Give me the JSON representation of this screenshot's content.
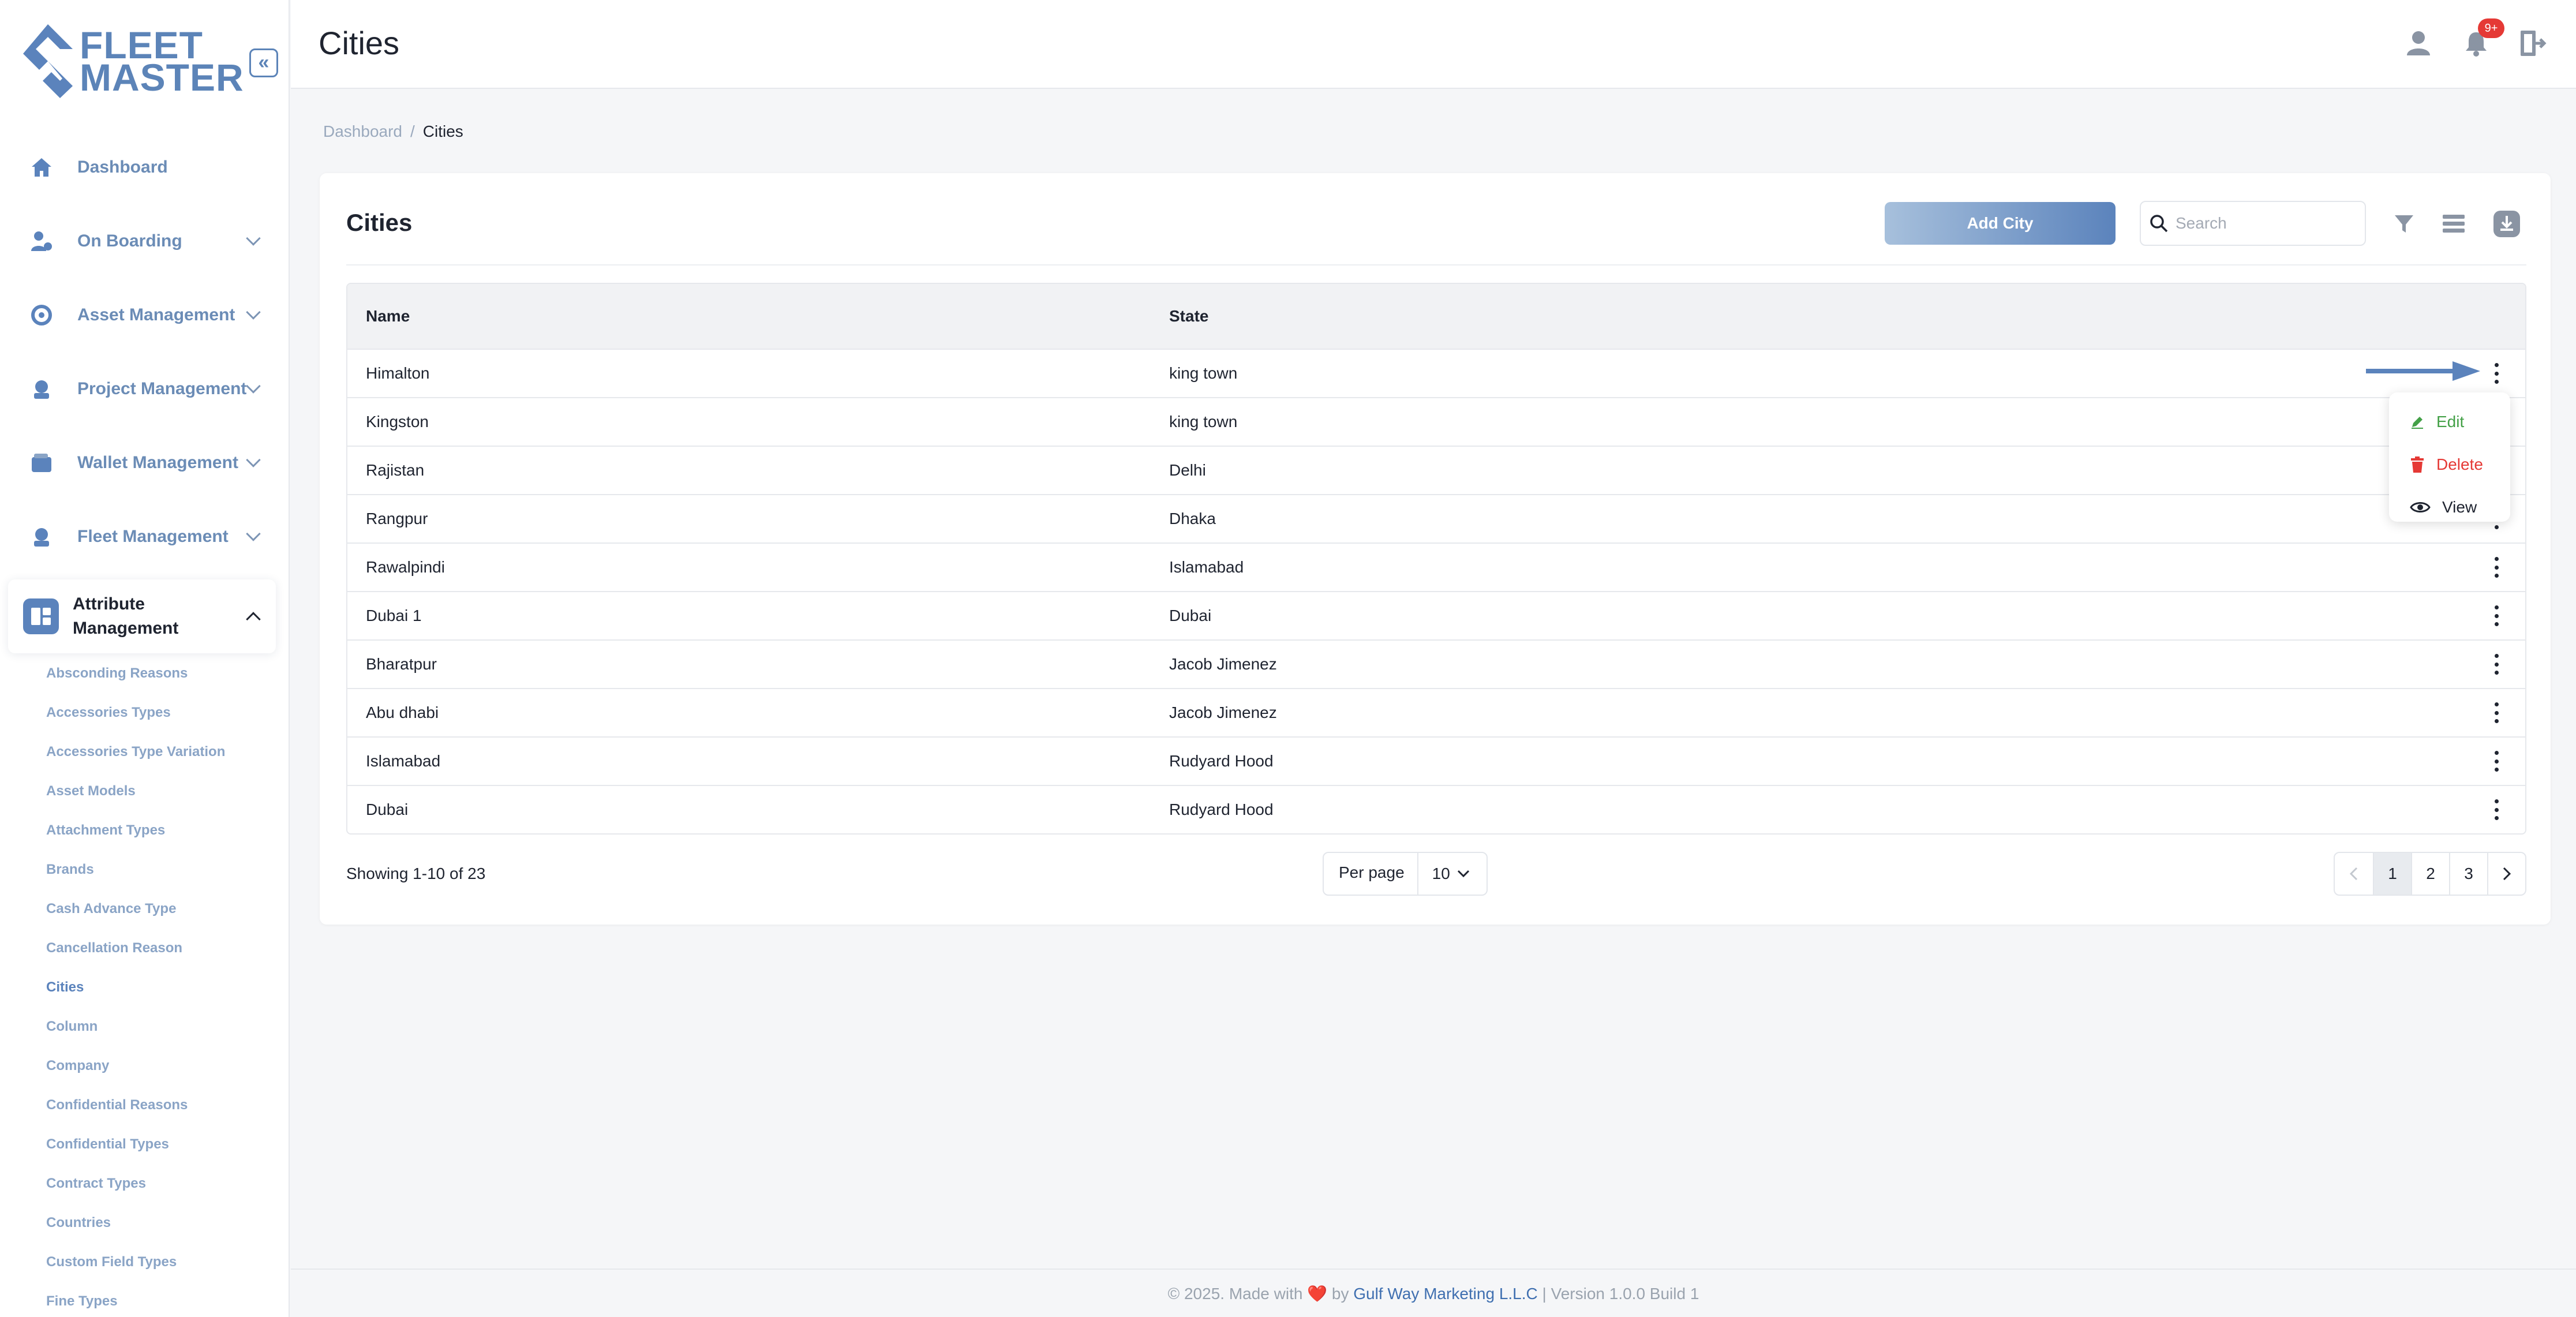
{
  "app": {
    "logo_text_line1": "FLEET",
    "logo_text_line2": "MASTER",
    "collapse_glyph": "«"
  },
  "nav": [
    {
      "label": "Dashboard",
      "icon": "home-icon",
      "expandable": false
    },
    {
      "label": "On Boarding",
      "icon": "onboarding-icon",
      "expandable": true
    },
    {
      "label": "Asset Management",
      "icon": "asset-icon",
      "expandable": true
    },
    {
      "label": "Project Management",
      "icon": "project-icon",
      "expandable": true
    },
    {
      "label": "Wallet Management",
      "icon": "wallet-icon",
      "expandable": true
    },
    {
      "label": "Fleet Management",
      "icon": "fleet-icon",
      "expandable": true
    },
    {
      "label": "Attribute Management",
      "icon": "attribute-icon",
      "expandable": true,
      "expanded": true
    }
  ],
  "subnav": [
    "Absconding Reasons",
    "Accessories Types",
    "Accessories Type Variation",
    "Asset Models",
    "Attachment Types",
    "Brands",
    "Cash Advance Type",
    "Cancellation Reason",
    "Cities",
    "Column",
    "Company",
    "Confidential Reasons",
    "Confidential Types",
    "Contract Types",
    "Countries",
    "Custom Field Types",
    "Fine Types"
  ],
  "subnav_selected": "Cities",
  "header": {
    "title": "Cities",
    "notif_badge": "9+"
  },
  "breadcrumb": {
    "root": "Dashboard",
    "sep": "/",
    "current": "Cities"
  },
  "card": {
    "title": "Cities",
    "add_label": "Add City",
    "search_placeholder": "Search"
  },
  "table": {
    "headers": [
      "Name",
      "State"
    ],
    "rows": [
      [
        "Himalton",
        "king town"
      ],
      [
        "Kingston",
        "king town"
      ],
      [
        "Rajistan",
        "Delhi"
      ],
      [
        "Rangpur",
        "Dhaka"
      ],
      [
        "Rawalpindi",
        "Islamabad"
      ],
      [
        "Dubai 1",
        "Dubai"
      ],
      [
        "Bharatpur",
        "Jacob Jimenez"
      ],
      [
        "Abu dhabi",
        "Jacob Jimenez"
      ],
      [
        "Islamabad",
        "Rudyard Hood"
      ],
      [
        "Dubai",
        "Rudyard Hood"
      ]
    ]
  },
  "row_menu": {
    "edit": "Edit",
    "delete": "Delete",
    "view": "View"
  },
  "pagination": {
    "showing": "Showing 1-10 of 23",
    "per_page_label": "Per page",
    "per_page_value": "10",
    "pages": [
      "1",
      "2",
      "3"
    ],
    "current": "1"
  },
  "footer": {
    "prefix": "© 2025. Made with",
    "heart": "❤️",
    "by": "by",
    "company": "Gulf Way Marketing L.L.C",
    "version": "| Version 1.0.0 Build 1"
  },
  "colors": {
    "accent": "#5b83bc",
    "edit": "#43a047",
    "delete": "#e53935",
    "badge": "#e53935"
  }
}
